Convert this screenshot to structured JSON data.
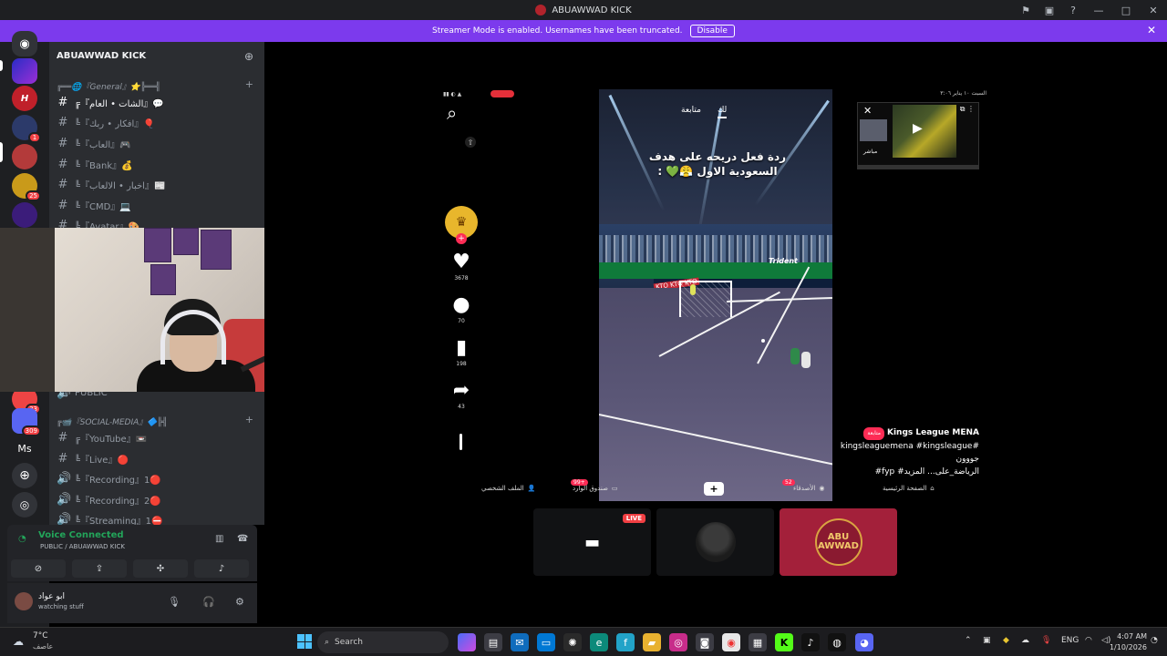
{
  "window": {
    "title": "ABUAWWAD KICK",
    "controls": [
      "flag-icon",
      "monitor-icon",
      "help-icon",
      "minimize-icon",
      "maximize-icon",
      "close-icon"
    ]
  },
  "banner": {
    "text": "Streamer Mode is enabled. Usernames have been truncated.",
    "button": "Disable",
    "color": "#7c3aed"
  },
  "server_rail": {
    "badges": [
      "1",
      "25",
      "33",
      "309"
    ],
    "ms_label": "Ms"
  },
  "guild": {
    "name": "ABUAWWAD KICK"
  },
  "channels": {
    "category_general": "╔══🌐『General』⭐╠══╣",
    "items": [
      {
        "name": "╔『الشات • العام』💬",
        "type": "text",
        "active": true
      },
      {
        "name": "╚『افكار • ربك』🎈",
        "type": "text"
      },
      {
        "name": "╚『العاب』🎮",
        "type": "text"
      },
      {
        "name": "╚『Bank』💰",
        "type": "text"
      },
      {
        "name": "╚『اخبار • الالعاب』📰",
        "type": "text"
      },
      {
        "name": "╚『CMD』💻",
        "type": "text"
      },
      {
        "name": "╚『Avatar』🎨",
        "type": "text"
      }
    ],
    "voice_public": "PUBLIC",
    "category_social": "╔📹『SOCIAL-MEDIA』🔷╠╣",
    "social_items": [
      {
        "name": "╔『YouTube』📼",
        "type": "text"
      },
      {
        "name": "╚『Live』🔴",
        "type": "text"
      },
      {
        "name": "╚『Recording』1🔴",
        "type": "voice"
      },
      {
        "name": "╚『Recording』2🔴",
        "type": "voice"
      },
      {
        "name": "╚『Streaming』1⛔",
        "type": "voice"
      }
    ]
  },
  "voice_panel": {
    "status": "Voice Connected",
    "channel": "PUBLIC / ABUAWWAD KICK"
  },
  "user": {
    "name": "ابو عواد",
    "status": "watching stuff"
  },
  "tiktok": {
    "tabs": [
      "متابعة",
      "لك"
    ],
    "caption": "ردة فعل دريحه على هدف السعودية الاول 😤💚 :",
    "counts": {
      "likes": "3678",
      "comments": "70",
      "saves": "198",
      "shares": "43"
    },
    "mini_player": {
      "live_label": "مباشر",
      "date": "السبت ١٠ يناير ٣:٠٦"
    },
    "desc": {
      "author": "Kings League MENA",
      "follow": "متابعة",
      "line1": "kingsleaguemena #kingsleague# جووون",
      "line2": "#fyp #الرياضة_على... المزيد"
    },
    "nav": {
      "home": "الصفحة الرئيسية",
      "friends": "الأصدقاء",
      "friends_badge": "52",
      "inbox": "صندوق الوارد",
      "inbox_badge": "99+",
      "profile": "الملف الشخصي"
    },
    "video_text": {
      "sponsor": "Trident",
      "board": "KTO KTO KTO"
    }
  },
  "tiles": {
    "live_label": "LIVE",
    "abu_logo": "ABU AWWAD"
  },
  "taskbar": {
    "temp": "7°C",
    "condition": "عاصف",
    "search": "Search",
    "lang": "ENG",
    "time": "4:07 AM",
    "date": "1/10/2026"
  }
}
